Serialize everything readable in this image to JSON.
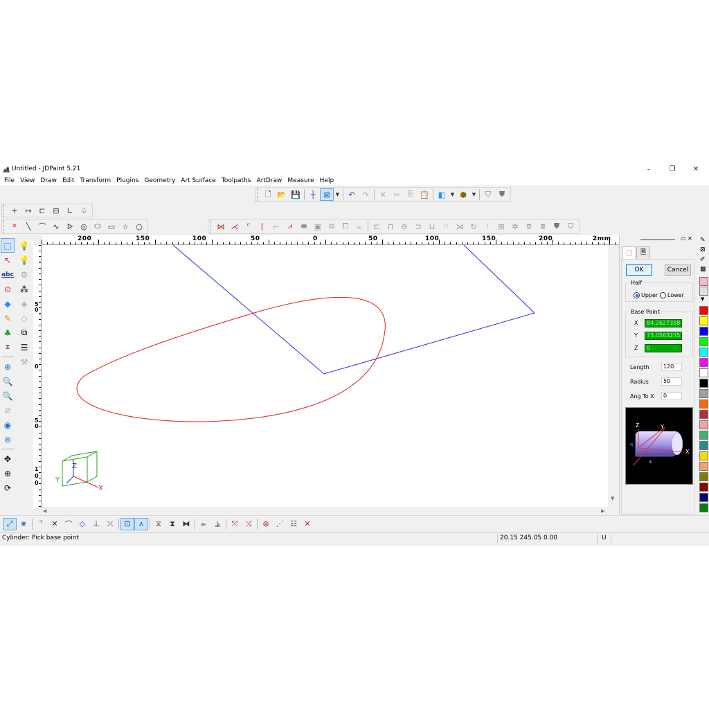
{
  "window": {
    "title": "Untitled - JDPaint 5.21",
    "minimize": "–",
    "maximize": "❐",
    "close": "✕"
  },
  "menu": [
    "File",
    "View",
    "Draw",
    "Edit",
    "Transform",
    "Plugins",
    "Geometry",
    "Art Surface",
    "Toolpaths",
    "ArtDraw",
    "Measure",
    "Help"
  ],
  "ruler": {
    "h_labels": [
      "200",
      "150",
      "100",
      "50",
      "0",
      "50",
      "100",
      "150",
      "200",
      "2mm"
    ],
    "v_labels": [
      "5",
      "0",
      "0",
      "5",
      "0",
      "1",
      "0",
      "0"
    ]
  },
  "canvas": {
    "axis_labels": {
      "z": "Z",
      "y": "Y",
      "x": "X"
    },
    "colors": {
      "curve": "#e02020",
      "box": "#2030d0",
      "axis_x": "#e02020",
      "axis_y": "#2030d0",
      "axis_z": "#2030d0",
      "cube": "#20a020"
    }
  },
  "panel": {
    "ok": "OK",
    "cancel": "Cancel",
    "half_label": "Half",
    "upper": "Upper",
    "lower": "Lower",
    "base_point_label": "Base Point",
    "x_label": "X",
    "y_label": "Y",
    "z_label": "Z",
    "x_value": "84.262735847",
    "y_value": "73.056323521",
    "z_value": "0",
    "length_label": "Length",
    "length_value": "120",
    "radius_label": "Radius",
    "radius_value": "50",
    "angle_label": "Ang To X",
    "angle_value": "0",
    "preview_labels": {
      "z": "Z",
      "y": "Y",
      "x": "X",
      "r": "R",
      "l": "L"
    }
  },
  "palette": [
    "#f9b8c8",
    "#e0e0e0",
    "#ff0000",
    "#ffff00",
    "#0000ff",
    "#00ff00",
    "#00ffff",
    "#ff00ff",
    "#ffffff",
    "#000000",
    "#a0a0a0",
    "#ff6600",
    "#b03030",
    "#f4a0a8",
    "#3cb371",
    "#2e8b8b",
    "#ffd700",
    "#f4a460",
    "#808000",
    "#8b0000",
    "#000080",
    "#008000"
  ],
  "status": {
    "prompt": "Cylinder: Pick base point",
    "coords": "20.15 245.05 0.00",
    "mode": "U"
  }
}
